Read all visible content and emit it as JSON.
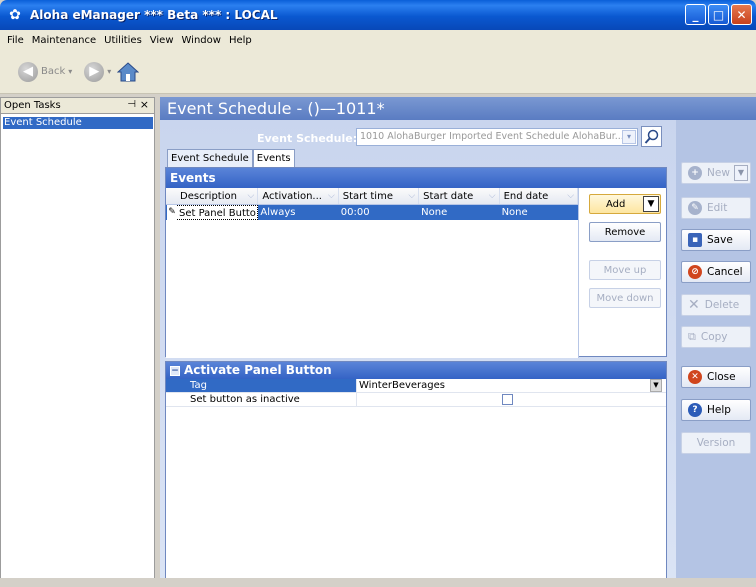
{
  "window": {
    "title": "Aloha eManager *** Beta *** : LOCAL"
  },
  "menu": [
    "File",
    "Maintenance",
    "Utilities",
    "View",
    "Window",
    "Help"
  ],
  "toolbar": {
    "back_label": "Back"
  },
  "left_panel": {
    "title": "Open Tasks",
    "items": [
      "Event Schedule"
    ]
  },
  "main": {
    "title": "Event Schedule - ()—1011*",
    "schedule_label": "Event Schedule:",
    "schedule_value": "1010 AlohaBurger Imported Event Schedule AlohaBur...",
    "tabs": [
      "Event Schedule",
      "Events"
    ],
    "active_tab": "Events"
  },
  "events": {
    "header": "Events",
    "columns": [
      "Description",
      "Activation...",
      "Start time",
      "Start date",
      "End date"
    ],
    "rows": [
      {
        "description": "Set Panel Butto",
        "activation": "Always",
        "start_time": "00:00",
        "start_date": "None",
        "end_date": "None"
      }
    ],
    "buttons": {
      "add": "Add",
      "remove": "Remove",
      "move_up": "Move up",
      "move_down": "Move down"
    }
  },
  "properties": {
    "header": "Activate Panel Button",
    "rows": [
      {
        "name": "Tag",
        "value": "WinterBeverages"
      },
      {
        "name": "Set button as inactive",
        "value": ""
      }
    ]
  },
  "actions": {
    "new": "New",
    "edit": "Edit",
    "save": "Save",
    "cancel": "Cancel",
    "delete": "Delete",
    "copy": "Copy",
    "close": "Close",
    "help": "Help",
    "version": "Version"
  }
}
